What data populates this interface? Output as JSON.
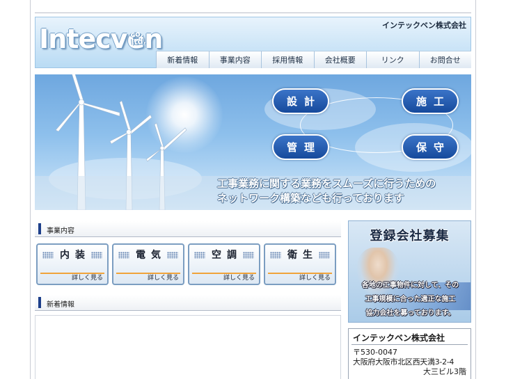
{
  "header": {
    "logo": "Intecven",
    "logo_suffix": "co. ltd.",
    "company_name": "インテックベン株式会社"
  },
  "nav": {
    "items": [
      {
        "label": "新着情報"
      },
      {
        "label": "事業内容"
      },
      {
        "label": "採用情報"
      },
      {
        "label": "会社概要"
      },
      {
        "label": "リンク"
      },
      {
        "label": "お問合せ"
      }
    ]
  },
  "hero": {
    "pills": [
      "設計",
      "施工",
      "管理",
      "保守"
    ],
    "tagline_line1": "工事業務に関する業務をスムーズに行うための",
    "tagline_line2": "ネットワーク構築なども行っております"
  },
  "business": {
    "heading": "事業内容",
    "tiles": [
      {
        "title": "内装",
        "more": "詳しく見る"
      },
      {
        "title": "電気",
        "more": "詳しく見る"
      },
      {
        "title": "空調",
        "more": "詳しく見る"
      },
      {
        "title": "衛生",
        "more": "詳しく見る"
      }
    ]
  },
  "news": {
    "heading": "新着情報"
  },
  "recruit": {
    "title": "登録会社募集",
    "line1": "各地の工事物件に対して、その",
    "line2": "工事規模に合った適正な施工",
    "line3": "協力会社を募っております。"
  },
  "company": {
    "name": "インテックベン株式会社",
    "postal": "〒530-0047",
    "address1": "大阪府大阪市北区西天満3-2-4",
    "address2": "大三ビル3階"
  }
}
